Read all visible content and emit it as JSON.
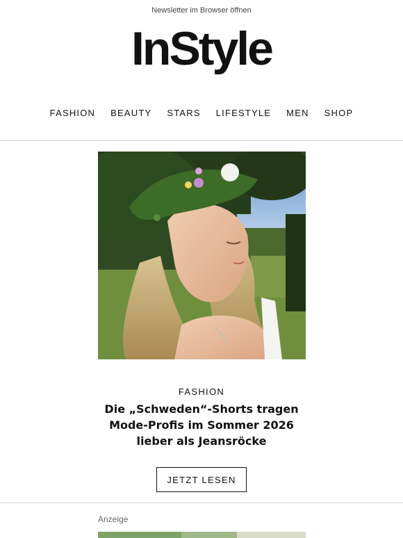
{
  "header": {
    "browser_link": "Newsletter im Browser öffnen",
    "logo": "InStyle"
  },
  "nav": {
    "items": [
      {
        "label": "FASHION"
      },
      {
        "label": "BEAUTY"
      },
      {
        "label": "STARS"
      },
      {
        "label": "LIFESTYLE"
      },
      {
        "label": "MEN"
      },
      {
        "label": "SHOP"
      }
    ]
  },
  "article": {
    "image_description_icon": "photo-woman-flower-crown",
    "category": "FASHION",
    "headline": "Die „Schweden“-Shorts tragen Mode-Profis im Sommer 2026 lieber als Jeansröcke",
    "cta_label": "JETZT LESEN"
  },
  "ad": {
    "label": "Anzeige"
  },
  "colors": {
    "text": "#111111",
    "divider": "#cfcfcf",
    "background": "#ffffff"
  }
}
